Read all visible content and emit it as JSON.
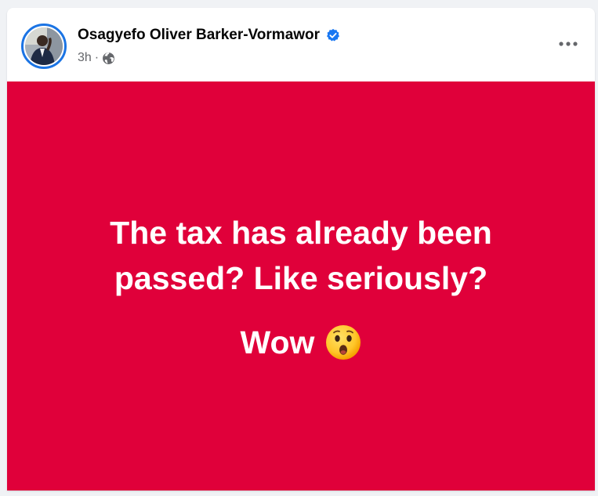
{
  "post": {
    "author_name": "Osagyefo Oliver Barker-Vormawor",
    "verified": true,
    "time": "3h",
    "separator": "·",
    "audience_icon": "globe-icon",
    "more_icon": "more-horizontal-icon",
    "background_color": "#e0003a",
    "text_color": "#ffffff",
    "body_lines": [
      "The tax has already been",
      "passed? Like seriously?",
      "Wow"
    ],
    "emoji": "face-with-open-mouth-emoji"
  },
  "colors": {
    "verified_badge": "#1877f2",
    "avatar_ring": "#1b74e4",
    "meta_text": "#65676b",
    "page_background": "#f0f2f5"
  }
}
